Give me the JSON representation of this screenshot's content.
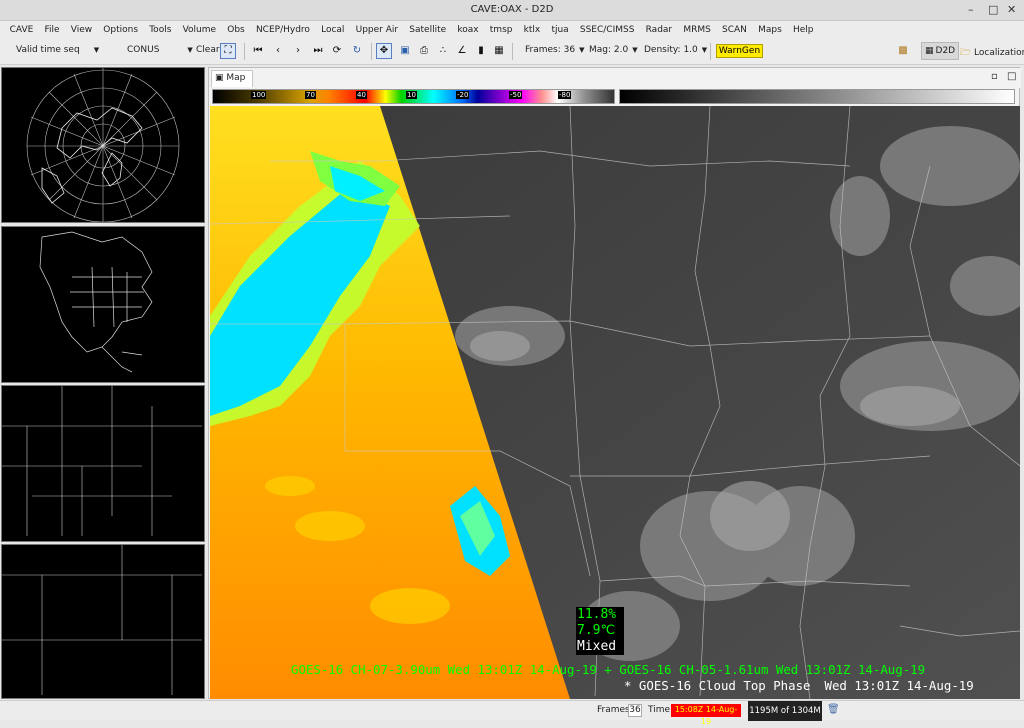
{
  "window": {
    "title": "CAVE:OAX - D2D"
  },
  "menu": [
    "CAVE",
    "File",
    "View",
    "Options",
    "Tools",
    "Volume",
    "Obs",
    "NCEP/Hydro",
    "Local",
    "Upper Air",
    "Satellite",
    "koax",
    "tmsp",
    "ktlx",
    "tjua",
    "SSEC/CIMSS",
    "Radar",
    "MRMS",
    "SCAN",
    "Maps",
    "Help"
  ],
  "toolbar": {
    "time_mode": "Valid time seq",
    "scale": "CONUS",
    "clear_label": "Clear",
    "frames_label": "Frames: 36",
    "mag_label": "Mag: 2.0",
    "density_label": "Density: 1.0",
    "warngen_label": "WarnGen",
    "d2d_label": "D2D",
    "localization_label": "Localization"
  },
  "map_tab": {
    "label": "Map"
  },
  "colorbar": {
    "labels": [
      "100",
      "70",
      "40",
      "10",
      "-20",
      "-50",
      "-80"
    ]
  },
  "sample_readout": {
    "line1": "11.8%",
    "line2": "7.9℃",
    "line3": "Mixed",
    "color_line1": "#00ff00",
    "color_line2": "#00ff00",
    "color_line3": "#ffffff"
  },
  "legend": {
    "line1": "GOES-16 CH-07-3.90um   Wed 13:01Z 14-Aug-19 + GOES-16 CH-05-1.61um   Wed 13:01Z 14-Aug-19",
    "line2_product": "* GOES-16 Cloud Top Phase",
    "line2_time": "Wed 13:01Z 14-Aug-19",
    "color_line1": "#00ff00",
    "color_line2": "#ffffff"
  },
  "status": {
    "frames_label": "Frames:",
    "frames_value": "36",
    "time_label": "Time:",
    "time_value": "15:08Z 14-Aug-19",
    "memory": "1195M of 1304M"
  },
  "colors": {
    "warngen": "#ffeb00",
    "time_alert": "#ff0000"
  },
  "icons": [
    "maximize-icon",
    "close-icon",
    "zoom-box-icon",
    "first-frame-icon",
    "step-back-icon",
    "step-forward-icon",
    "last-frame-icon",
    "loop-icon",
    "refresh-icon",
    "pan-icon",
    "zoom-icon",
    "print-icon",
    "points-icon",
    "baselines-icon",
    "blink-icon",
    "contrast-icon",
    "perspective-icon",
    "localization-icon",
    "trash-icon"
  ]
}
